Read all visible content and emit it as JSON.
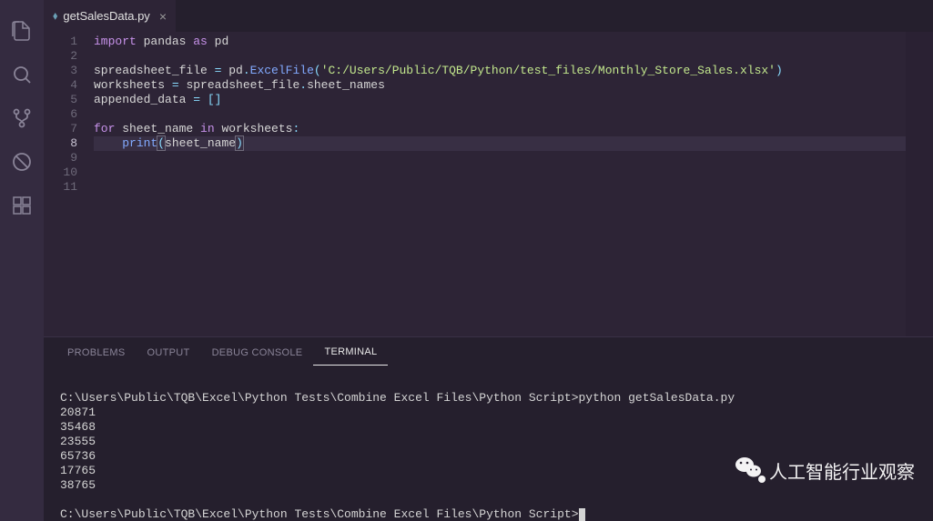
{
  "tab": {
    "filename": "getSalesData.py",
    "icon": "python"
  },
  "code": {
    "lines": [
      {
        "n": 1,
        "tokens": [
          [
            "kw",
            "import"
          ],
          [
            "var",
            " pandas "
          ],
          [
            "op2",
            "as"
          ],
          [
            "var",
            " pd"
          ]
        ]
      },
      {
        "n": 2,
        "tokens": []
      },
      {
        "n": 3,
        "tokens": [
          [
            "var",
            "spreadsheet_file "
          ],
          [
            "op",
            "="
          ],
          [
            "var",
            " pd"
          ],
          [
            "op",
            "."
          ],
          [
            "fn",
            "ExcelFile"
          ],
          [
            "op",
            "("
          ],
          [
            "str",
            "'C:/Users/Public/TQB/Python/test_files/Monthly_Store_Sales.xlsx'"
          ],
          [
            "op",
            ")"
          ]
        ]
      },
      {
        "n": 4,
        "tokens": [
          [
            "var",
            "worksheets "
          ],
          [
            "op",
            "="
          ],
          [
            "var",
            " spreadsheet_file"
          ],
          [
            "op",
            "."
          ],
          [
            "var",
            "sheet_names"
          ]
        ]
      },
      {
        "n": 5,
        "tokens": [
          [
            "var",
            "appended_data "
          ],
          [
            "op",
            "="
          ],
          [
            "var",
            " "
          ],
          [
            "op",
            "[]"
          ]
        ]
      },
      {
        "n": 6,
        "tokens": []
      },
      {
        "n": 7,
        "tokens": [
          [
            "kw",
            "for"
          ],
          [
            "var",
            " sheet_name "
          ],
          [
            "op2",
            "in"
          ],
          [
            "var",
            " worksheets"
          ],
          [
            "op",
            ":"
          ]
        ]
      },
      {
        "n": 8,
        "tokens": [
          [
            "var",
            "    "
          ],
          [
            "fn",
            "print"
          ],
          [
            "op-paren",
            "("
          ],
          [
            "var",
            "sheet_name"
          ],
          [
            "op-paren",
            ")"
          ]
        ]
      },
      {
        "n": 9,
        "tokens": []
      },
      {
        "n": 10,
        "tokens": []
      },
      {
        "n": 11,
        "tokens": []
      }
    ],
    "currentLine": 8
  },
  "panel": {
    "tabs": [
      "PROBLEMS",
      "OUTPUT",
      "DEBUG CONSOLE",
      "TERMINAL"
    ],
    "active": "TERMINAL"
  },
  "terminal": {
    "prompt_path": "C:\\Users\\Public\\TQB\\Excel\\Python Tests\\Combine Excel Files\\Python Script>",
    "command": "python getSalesData.py",
    "output": [
      "20871",
      "35468",
      "23555",
      "65736",
      "17765",
      "38765"
    ]
  },
  "watermark": "人工智能行业观察"
}
